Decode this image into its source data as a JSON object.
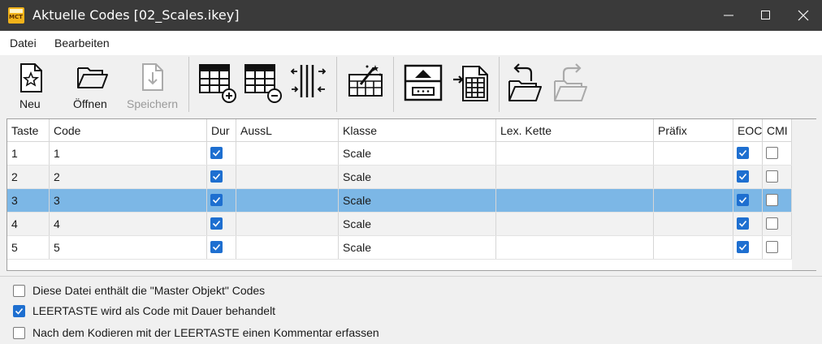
{
  "window": {
    "title": "Aktuelle Codes [02_Scales.ikey]",
    "icon": "mct-app-icon",
    "titlebar_color": "#3a3a3a"
  },
  "menu": {
    "items": [
      "Datei",
      "Bearbeiten"
    ]
  },
  "toolbar": {
    "new_label": "Neu",
    "open_label": "Öffnen",
    "save_label": "Speichern",
    "save_enabled": false,
    "icons": [
      "new-file-icon",
      "open-folder-icon",
      "save-icon",
      "add-row-icon",
      "remove-row-icon",
      "columns-icon",
      "magic-wand-grid-icon",
      "keyboard-import-icon",
      "grid-export-icon",
      "undo-folder-icon",
      "redo-folder-icon"
    ]
  },
  "table": {
    "headers": [
      "Taste",
      "Code",
      "Dur",
      "AussL",
      "Klasse",
      "Lex. Kette",
      "Präfix",
      "EOC",
      "CMI"
    ],
    "rows": [
      {
        "taste": "1",
        "code": "1",
        "dur": true,
        "aussl": "",
        "klasse": "Scale",
        "lex": "",
        "praefix": "",
        "eoc": true,
        "cmi": false
      },
      {
        "taste": "2",
        "code": "2",
        "dur": true,
        "aussl": "",
        "klasse": "Scale",
        "lex": "",
        "praefix": "",
        "eoc": true,
        "cmi": false
      },
      {
        "taste": "3",
        "code": "3",
        "dur": true,
        "aussl": "",
        "klasse": "Scale",
        "lex": "",
        "praefix": "",
        "eoc": true,
        "cmi": false
      },
      {
        "taste": "4",
        "code": "4",
        "dur": true,
        "aussl": "",
        "klasse": "Scale",
        "lex": "",
        "praefix": "",
        "eoc": true,
        "cmi": false
      },
      {
        "taste": "5",
        "code": "5",
        "dur": true,
        "aussl": "",
        "klasse": "Scale",
        "lex": "",
        "praefix": "",
        "eoc": true,
        "cmi": false
      }
    ],
    "selected_row": 3,
    "selection_color": "#7cb7e6",
    "checkbox_color": "#1e6fd0"
  },
  "options": [
    {
      "label": "Diese Datei enthält die \"Master Objekt\" Codes",
      "checked": false
    },
    {
      "label": "LEERTASTE wird als Code mit Dauer behandelt",
      "checked": true
    },
    {
      "label": "Nach dem Kodieren mit der LEERTASTE einen Kommentar erfassen",
      "checked": false
    }
  ]
}
